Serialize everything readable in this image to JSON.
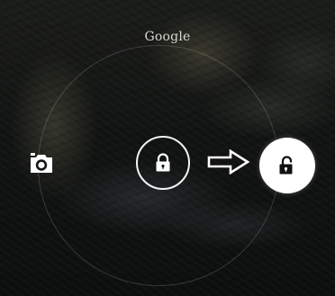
{
  "lockscreen": {
    "brand": "Google",
    "icons": {
      "camera": "camera-icon",
      "lock": "lock-icon",
      "arrow": "arrow-right-icon",
      "unlock": "unlock-icon"
    },
    "colors": {
      "ring": "#ffffff",
      "unlock_target_bg": "#ffffff",
      "unlock_icon": "#111111"
    }
  }
}
